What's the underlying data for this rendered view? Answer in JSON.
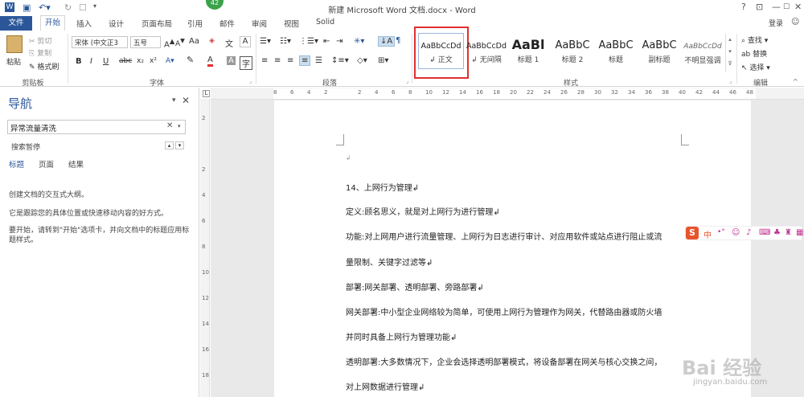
{
  "app": {
    "title": "新建 Microsoft Word 文档.docx - Word",
    "badge": "42",
    "help": "?",
    "win_min": "—",
    "win_max": "☐",
    "win_close": "✕",
    "login": "登录"
  },
  "tabs": [
    "文件",
    "开始",
    "插入",
    "设计",
    "页面布局",
    "引用",
    "邮件",
    "审阅",
    "视图",
    "Solid"
  ],
  "clipboard": {
    "paste": "粘贴",
    "cut": "剪切",
    "copy": "复制",
    "format_painter": "格式刷",
    "group": "剪贴板"
  },
  "font": {
    "name": "宋体 (中文正3",
    "size": "五号",
    "group": "字体",
    "b": "B",
    "i": "I",
    "u": "U",
    "abc": "abc",
    "sub": "x₂",
    "sup": "x²",
    "aa": "Aa",
    "a1": "A",
    "a2": "A",
    "big_a": "A",
    "shade_a": "A",
    "wen": "文",
    "A_case": "Aa"
  },
  "paragraph": {
    "group": "段落"
  },
  "styles": {
    "group": "样式",
    "items": [
      {
        "preview": "AaBbCcDd",
        "name": "↲ 正文"
      },
      {
        "preview": "AaBbCcDd",
        "name": "↲ 无间隔"
      },
      {
        "preview": "AaBl",
        "name": "标题 1"
      },
      {
        "preview": "AaBbC",
        "name": "标题 2"
      },
      {
        "preview": "AaBbC",
        "name": "标题"
      },
      {
        "preview": "AaBbC",
        "name": "副标题"
      },
      {
        "preview": "AaBbCcDd",
        "name": "不明显强调"
      }
    ]
  },
  "editing": {
    "group": "编辑",
    "find": "查找",
    "replace": "替换",
    "select": "选择"
  },
  "nav": {
    "title": "导航",
    "search_value": "异常流量清洗",
    "status": "搜索暂停",
    "tabs": [
      "标题",
      "页面",
      "结果"
    ],
    "msg1": "创建文档的交互式大纲。",
    "msg2": "它是跟踪您的具体位置或快速移动内容的好方式。",
    "msg3": "要开始，请转到\"开始\"选项卡，并向文档中的标题应用标题样式。"
  },
  "ruler": {
    "ticks": [
      "8",
      "6",
      "4",
      "2",
      "",
      "2",
      "4",
      "6",
      "8",
      "10",
      "12",
      "14",
      "16",
      "18",
      "20",
      "22",
      "24",
      "26",
      "28",
      "30",
      "32",
      "34",
      "36",
      "38",
      "40",
      "42",
      "44",
      "46",
      "48"
    ],
    "left_ticks": [
      "2",
      "",
      "2",
      "4",
      "6",
      "8",
      "10",
      "12",
      "14",
      "16",
      "18"
    ]
  },
  "document": {
    "lines": [
      "14、上网行为管理↲",
      "定义:顾名思义，就是对上网行为进行管理↲",
      "功能:对上网用户进行流量管理、上网行为日志进行审计、对应用软件或站点进行阻止或流",
      "量限制、关键字过滤等↲",
      "部署:网关部署、透明部署、旁路部署↲",
      "网关部署:中小型企业网络较为简单，可使用上网行为管理作为网关，代替路由器或防火墙",
      "并同时具备上网行为管理功能↲",
      "透明部署:大多数情况下，企业会选择透明部署模式，将设备部署在网关与核心交换之间，",
      "对上网数据进行管理↲"
    ]
  },
  "ime": {
    "logo": "S",
    "mode": "中",
    "punct": "•°"
  },
  "watermark": {
    "text": "Bai 经验",
    "url": "jingyan.baidu.com"
  },
  "colors": {
    "brand": "#2b579a",
    "highlight": "#e03030"
  }
}
